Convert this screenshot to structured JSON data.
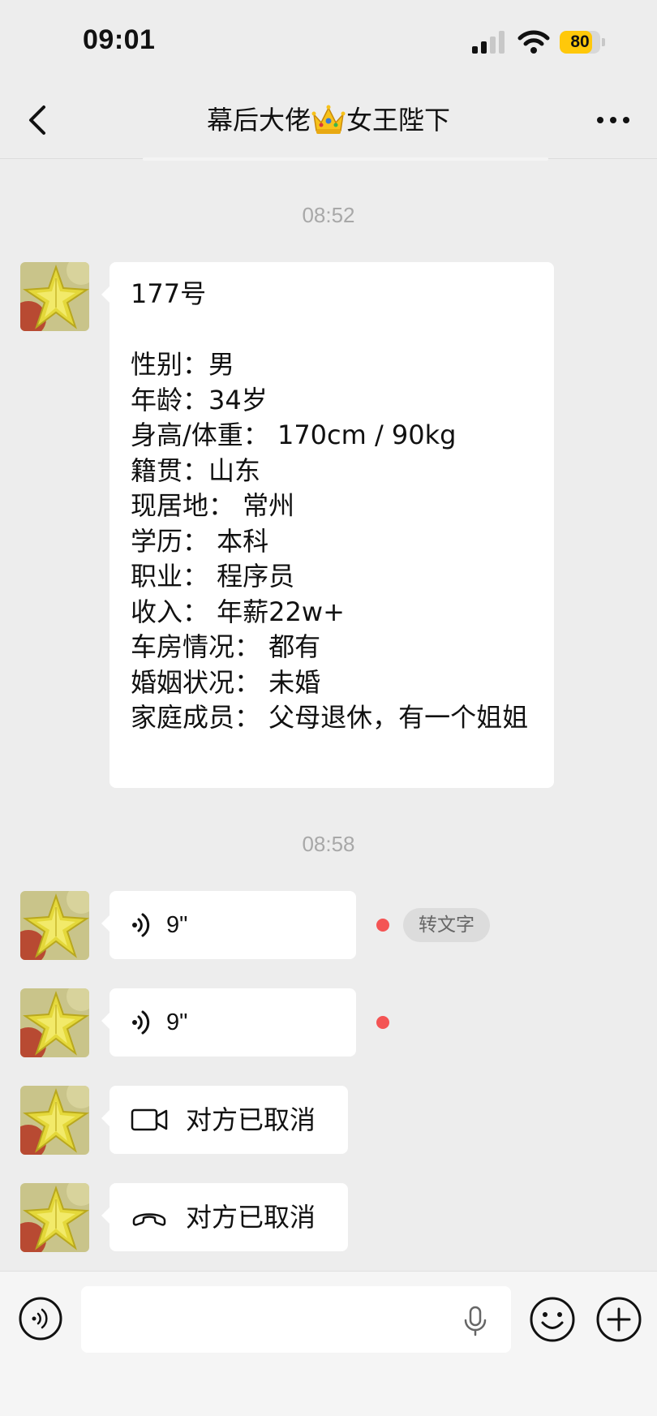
{
  "status_bar": {
    "time": "09:01",
    "battery_level": "80",
    "battery_fraction": 0.8,
    "signal_icon": "cellular-signal-icon",
    "wifi_icon": "wifi-icon"
  },
  "nav": {
    "title_before": "幕后大佬",
    "title_emoji": "crown-emoji",
    "title_after": "女王陛下",
    "back_icon": "chevron-left-icon",
    "more_icon": "more-dots-icon"
  },
  "messages": {
    "timestamp_1": "08:52",
    "profile_lines": [
      "177号",
      "",
      "性别：男",
      "年龄：34岁",
      "身高/体重： 170cm / 90kg",
      "籍贯：山东",
      "现居地： 常州",
      "学历： 本科",
      "职业： 程序员",
      "收入： 年薪22w+",
      "车房情况： 都有",
      "婚姻状况： 未婚",
      "家庭成员： 父母退休，有一个姐姐"
    ],
    "timestamp_2": "08:58",
    "voice_1": {
      "duration": "9\"",
      "transcribe_label": "转文字",
      "unread": true
    },
    "voice_2": {
      "duration": "9\"",
      "unread": true
    },
    "video_call": {
      "text": "对方已取消",
      "icon": "video-camera-icon"
    },
    "voice_call": {
      "text": "对方已取消",
      "icon": "phone-hangup-icon"
    }
  },
  "input_bar": {
    "placeholder": "",
    "voice_mode_icon": "voice-mode-icon",
    "mic_icon": "microphone-icon",
    "emoji_icon": "smiley-icon",
    "plus_icon": "plus-circle-icon"
  },
  "colors": {
    "background": "#ededed",
    "bubble": "#ffffff",
    "unread_dot": "#f45454",
    "battery_fill": "#ffc80a"
  }
}
